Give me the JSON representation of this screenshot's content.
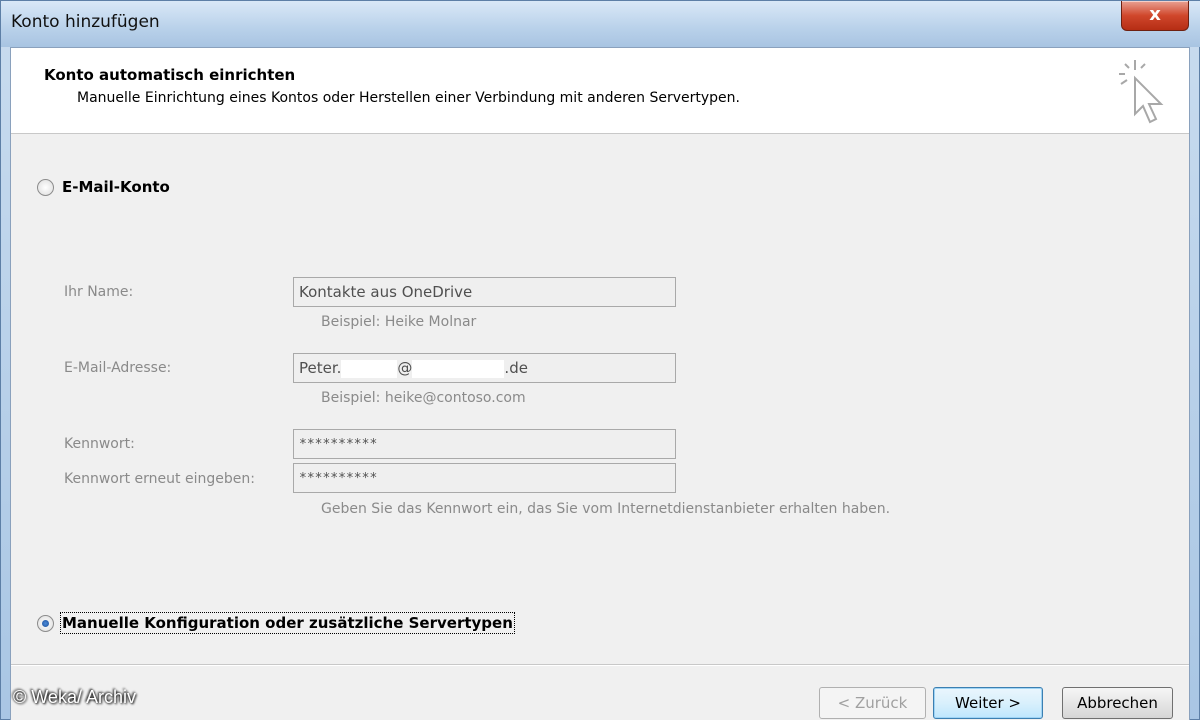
{
  "window": {
    "title": "Konto hinzufügen",
    "close_label": "x"
  },
  "header": {
    "title": "Konto automatisch einrichten",
    "subtitle": "Manuelle Einrichtung eines Kontos oder Herstellen einer Verbindung mit anderen Servertypen."
  },
  "options": {
    "email_account": {
      "label": "E-Mail-Konto",
      "checked": false
    },
    "manual_config": {
      "label": "Manuelle Konfiguration oder zusätzliche Servertypen",
      "checked": true
    }
  },
  "form": {
    "name": {
      "label": "Ihr Name:",
      "value": "Kontakte aus OneDrive",
      "hint": "Beispiel: Heike Molnar"
    },
    "email": {
      "label": "E-Mail-Adresse:",
      "value_prefix": "Peter.",
      "value_at": "@",
      "value_suffix": ".de",
      "hint": "Beispiel: heike@contoso.com"
    },
    "password": {
      "label": "Kennwort:",
      "value": "**********"
    },
    "password_repeat": {
      "label": "Kennwort erneut eingeben:",
      "value": "**********"
    },
    "password_hint": "Geben Sie das Kennwort ein, das Sie vom Internetdienstanbieter erhalten haben."
  },
  "buttons": {
    "back": "< Zurück",
    "next": "Weiter >",
    "cancel": "Abbrechen"
  },
  "watermark": "© Weka/ Archiv"
}
